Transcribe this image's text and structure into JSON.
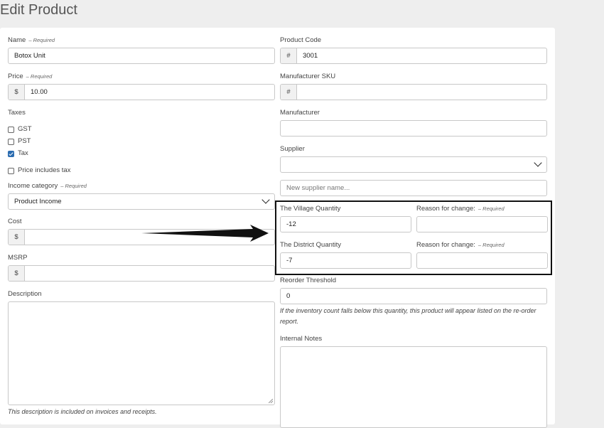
{
  "page": {
    "title": "Edit Product"
  },
  "required_text": "– Required",
  "left": {
    "name": {
      "label": "Name",
      "value": "Botox Unit"
    },
    "price": {
      "label": "Price",
      "addon": "$",
      "value": "10.00"
    },
    "taxes": {
      "label": "Taxes",
      "options": [
        {
          "label": "GST",
          "checked": false
        },
        {
          "label": "PST",
          "checked": false
        },
        {
          "label": "Tax",
          "checked": true
        }
      ],
      "price_includes_tax": {
        "label": "Price includes tax",
        "checked": false
      }
    },
    "income_category": {
      "label": "Income category",
      "value": "Product Income"
    },
    "cost": {
      "label": "Cost",
      "addon": "$",
      "value": ""
    },
    "msrp": {
      "label": "MSRP",
      "addon": "$",
      "value": ""
    },
    "description": {
      "label": "Description",
      "help": "This description is included on invoices and receipts."
    }
  },
  "right": {
    "product_code": {
      "label": "Product Code",
      "addon": "#",
      "value": "3001"
    },
    "manufacturer_sku": {
      "label": "Manufacturer SKU",
      "addon": "#",
      "value": ""
    },
    "manufacturer": {
      "label": "Manufacturer",
      "value": ""
    },
    "supplier": {
      "label": "Supplier",
      "value": "",
      "new_placeholder": "New supplier name..."
    },
    "village_quantity": {
      "label": "The Village Quantity",
      "value": "-12"
    },
    "village_reason": {
      "label": "Reason for change:",
      "value": ""
    },
    "district_quantity": {
      "label": "The District Quantity",
      "value": "-7"
    },
    "district_reason": {
      "label": "Reason for change:",
      "value": ""
    },
    "reorder_threshold": {
      "label": "Reorder Threshold",
      "value": "0",
      "help": "If the inventory count falls below this quantity, this product will appear listed on the re-order report."
    },
    "internal_notes": {
      "label": "Internal Notes"
    }
  },
  "colors": {
    "checkbox_checked": "#2b6cb0",
    "annotation": "#111111"
  }
}
